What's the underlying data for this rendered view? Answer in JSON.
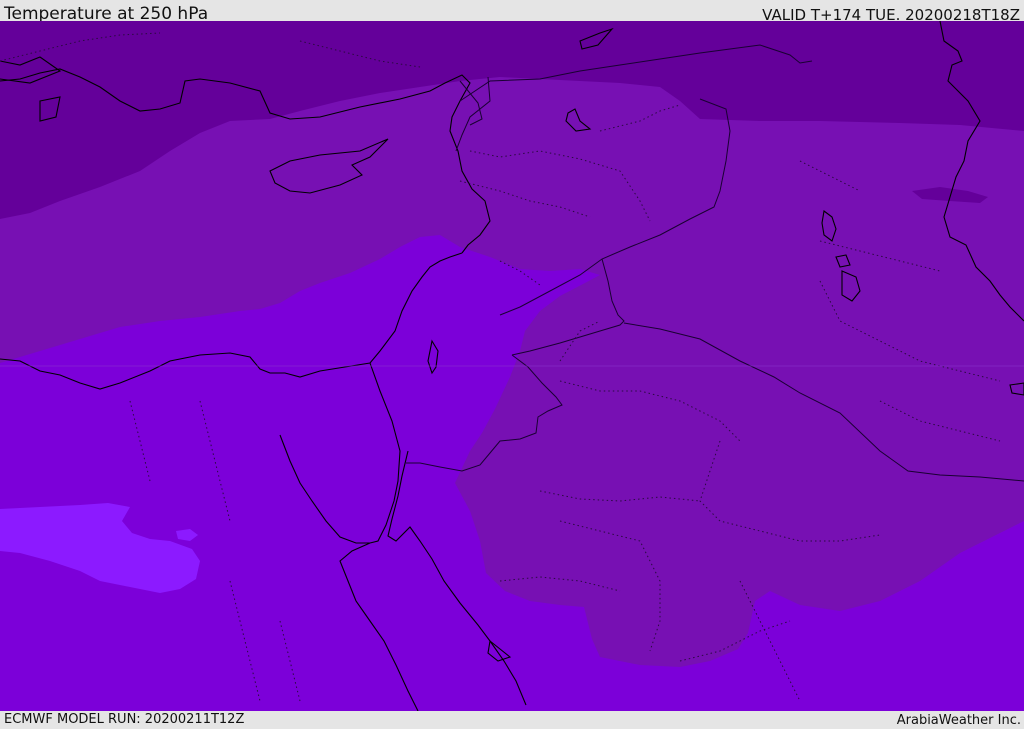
{
  "header": {
    "title": "Temperature at 250 hPa",
    "valid": "VALID T+174 TUE. 20200218T18Z"
  },
  "footer": {
    "model_run": "ECMWF MODEL RUN: 20200211T12Z",
    "credit": "ArabiaWeather Inc."
  },
  "colors": {
    "band_coldest": "#64009a",
    "band_cold": "#7710b3",
    "band_mid": "#7c00d9",
    "band_warm": "#8c1aff",
    "coastline": "#000000",
    "border": "#1a0033"
  }
}
